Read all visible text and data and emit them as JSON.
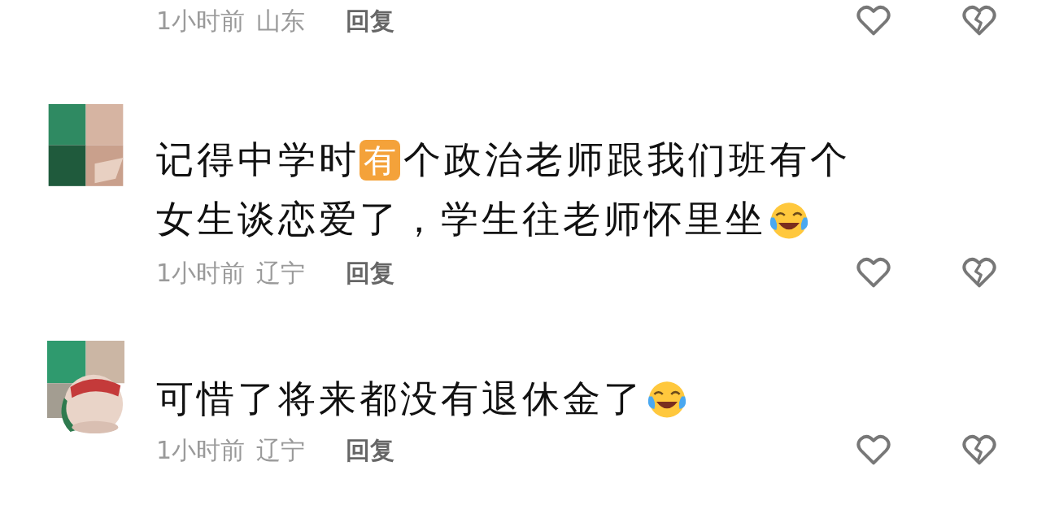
{
  "comments": [
    {
      "meta": {
        "time": "1小时前",
        "location": "山东",
        "reply": "回复"
      },
      "liked": false,
      "disliked": false
    },
    {
      "avatar": {
        "kind": "picture"
      },
      "lines": [
        [
          {
            "kind": "text",
            "text": "记得中学时"
          },
          {
            "kind": "badge",
            "text": "有"
          },
          {
            "kind": "text",
            "text": "个政治老师跟我们班有个"
          }
        ],
        [
          {
            "kind": "text",
            "text": "女生谈恋爱了，学生往老师怀里坐"
          },
          {
            "kind": "emoji"
          }
        ]
      ],
      "meta": {
        "time": "1小时前",
        "location": "辽宁",
        "reply": "回复"
      },
      "liked": false,
      "disliked": false
    },
    {
      "avatar": {
        "kind": "picture"
      },
      "lines": [
        [
          {
            "kind": "text",
            "text": "可惜了将来都没有退休金了"
          },
          {
            "kind": "emoji"
          }
        ]
      ],
      "meta": {
        "time": "1小时前",
        "location": "辽宁",
        "reply": "回复"
      },
      "liked": false,
      "disliked": false
    }
  ]
}
